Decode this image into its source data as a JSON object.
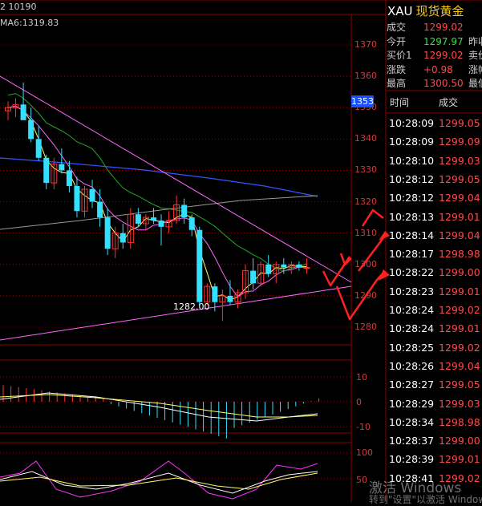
{
  "chart_header": {
    "code_label": "2 10190",
    "ma_label": "MA6:1319.83"
  },
  "quote": {
    "symbol": "XAU",
    "name": "现货黄金",
    "rows": [
      {
        "label": "成交",
        "value": "1299.02",
        "color": "#ff4a4a",
        "right": ""
      },
      {
        "label": "今开",
        "value": "1297.97",
        "color": "#2ee82e",
        "right": "昨收"
      },
      {
        "label": "买价1",
        "value": "1299.02",
        "color": "#ff4a4a",
        "right": "卖价"
      },
      {
        "label": "涨跌",
        "value": "+0.98",
        "color": "#ff4a4a",
        "right": "涨幅"
      },
      {
        "label": "最高",
        "value": "1300.50",
        "color": "#ff4a4a",
        "right": "最低"
      }
    ]
  },
  "ticks": {
    "time_header": "时间",
    "price_header": "成交",
    "rows": [
      {
        "time": "10:28:09",
        "price": "1299.05"
      },
      {
        "time": "10:28:09",
        "price": "1299.09"
      },
      {
        "time": "10:28:10",
        "price": "1299.03"
      },
      {
        "time": "10:28:12",
        "price": "1299.05"
      },
      {
        "time": "10:28:12",
        "price": "1299.04"
      },
      {
        "time": "10:28:13",
        "price": "1299.01"
      },
      {
        "time": "10:28:14",
        "price": "1299.04"
      },
      {
        "time": "10:28:17",
        "price": "1298.98"
      },
      {
        "time": "10:28:22",
        "price": "1299.00"
      },
      {
        "time": "10:28:23",
        "price": "1299.01"
      },
      {
        "time": "10:28:24",
        "price": "1299.02"
      },
      {
        "time": "10:28:24",
        "price": "1299.01"
      },
      {
        "time": "10:28:25",
        "price": "1299.02"
      },
      {
        "time": "10:28:26",
        "price": "1299.04"
      },
      {
        "time": "10:28:27",
        "price": "1299.05"
      },
      {
        "time": "10:28:29",
        "price": "1299.03"
      },
      {
        "time": "10:28:34",
        "price": "1298.98"
      },
      {
        "time": "10:28:37",
        "price": "1299.00"
      },
      {
        "time": "10:28:39",
        "price": "1299.01"
      },
      {
        "time": "10:28:41",
        "price": "1299.02"
      }
    ]
  },
  "price_axis": {
    "labels": [
      "1370",
      "1360",
      "1350",
      "1340",
      "1330",
      "1320",
      "1310",
      "1300",
      "1290",
      "1280"
    ],
    "current": "1353",
    "low_marker": "1282.00"
  },
  "macd_axis": {
    "labels": [
      "10",
      "0",
      "-10"
    ]
  },
  "kdj_axis": {
    "labels": [
      "100",
      "50"
    ]
  },
  "watermark": {
    "line1": "激活 Windows",
    "line2": "转到\"设置\"以激活 Windows。"
  },
  "colors": {
    "up": "#ff3333",
    "down": "#33e0ff",
    "grid": "#8b0000",
    "ma_fast": "#ffff66",
    "ma_mid": "#ff66ff",
    "ma_green": "#22aa22",
    "ma_blue": "#3355ff",
    "ma_gray": "#999999",
    "annotation": "#ff2020"
  },
  "chart_data": {
    "type": "candlestick",
    "candles": [
      {
        "o": 1349,
        "h": 1352,
        "l": 1346,
        "c": 1350
      },
      {
        "o": 1350,
        "h": 1353,
        "l": 1347,
        "c": 1351
      },
      {
        "o": 1351,
        "h": 1358,
        "l": 1348,
        "c": 1346
      },
      {
        "o": 1346,
        "h": 1350,
        "l": 1339,
        "c": 1340
      },
      {
        "o": 1340,
        "h": 1344,
        "l": 1333,
        "c": 1334
      },
      {
        "o": 1334,
        "h": 1335,
        "l": 1324,
        "c": 1326
      },
      {
        "o": 1326,
        "h": 1334,
        "l": 1324,
        "c": 1332
      },
      {
        "o": 1332,
        "h": 1337,
        "l": 1329,
        "c": 1330
      },
      {
        "o": 1330,
        "h": 1333,
        "l": 1323,
        "c": 1325
      },
      {
        "o": 1325,
        "h": 1328,
        "l": 1315,
        "c": 1317
      },
      {
        "o": 1317,
        "h": 1325,
        "l": 1315,
        "c": 1324
      },
      {
        "o": 1324,
        "h": 1327,
        "l": 1318,
        "c": 1320
      },
      {
        "o": 1320,
        "h": 1324,
        "l": 1312,
        "c": 1315
      },
      {
        "o": 1315,
        "h": 1318,
        "l": 1303,
        "c": 1305
      },
      {
        "o": 1305,
        "h": 1312,
        "l": 1302,
        "c": 1310
      },
      {
        "o": 1310,
        "h": 1313,
        "l": 1305,
        "c": 1307
      },
      {
        "o": 1307,
        "h": 1318,
        "l": 1305,
        "c": 1316
      },
      {
        "o": 1316,
        "h": 1318,
        "l": 1312,
        "c": 1313
      },
      {
        "o": 1313,
        "h": 1316,
        "l": 1311,
        "c": 1315
      },
      {
        "o": 1315,
        "h": 1318,
        "l": 1313,
        "c": 1314
      },
      {
        "o": 1314,
        "h": 1316,
        "l": 1306,
        "c": 1312
      },
      {
        "o": 1312,
        "h": 1317,
        "l": 1310,
        "c": 1314
      },
      {
        "o": 1314,
        "h": 1322,
        "l": 1313,
        "c": 1319
      },
      {
        "o": 1319,
        "h": 1321,
        "l": 1313,
        "c": 1315
      },
      {
        "o": 1315,
        "h": 1316,
        "l": 1309,
        "c": 1311
      },
      {
        "o": 1311,
        "h": 1312,
        "l": 1287,
        "c": 1288
      },
      {
        "o": 1288,
        "h": 1294,
        "l": 1287,
        "c": 1293
      },
      {
        "o": 1293,
        "h": 1294,
        "l": 1285,
        "c": 1288
      },
      {
        "o": 1288,
        "h": 1292,
        "l": 1282,
        "c": 1290
      },
      {
        "o": 1290,
        "h": 1295,
        "l": 1287,
        "c": 1288
      },
      {
        "o": 1288,
        "h": 1292,
        "l": 1286,
        "c": 1291
      },
      {
        "o": 1291,
        "h": 1300,
        "l": 1289,
        "c": 1298
      },
      {
        "o": 1298,
        "h": 1302,
        "l": 1292,
        "c": 1294
      },
      {
        "o": 1294,
        "h": 1301,
        "l": 1293,
        "c": 1300
      },
      {
        "o": 1300,
        "h": 1303,
        "l": 1296,
        "c": 1297
      },
      {
        "o": 1297,
        "h": 1301,
        "l": 1294,
        "c": 1300
      },
      {
        "o": 1300,
        "h": 1302,
        "l": 1297,
        "c": 1299
      },
      {
        "o": 1299,
        "h": 1301,
        "l": 1297,
        "c": 1300
      },
      {
        "o": 1300,
        "h": 1301,
        "l": 1298,
        "c": 1299
      },
      {
        "o": 1299,
        "h": 1302,
        "l": 1297,
        "c": 1299
      }
    ],
    "ylim": [
      1276,
      1376
    ]
  }
}
